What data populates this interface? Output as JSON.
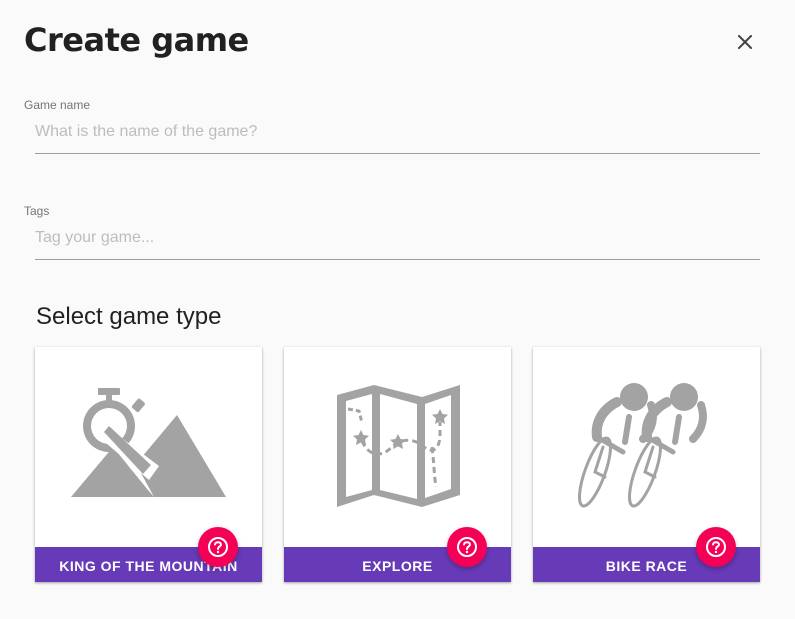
{
  "dialog": {
    "title": "Create game",
    "close_icon": "close-icon"
  },
  "fields": {
    "game_name": {
      "label": "Game name",
      "value": "",
      "placeholder": "What is the name of the game?"
    },
    "tags": {
      "label": "Tags",
      "value": "",
      "placeholder": "Tag your game..."
    }
  },
  "game_types": {
    "heading": "Select game type",
    "items": [
      {
        "label": "KING OF THE MOUNTAIN",
        "icon": "stopwatch-mountain-icon",
        "help_icon": "help-circle-icon"
      },
      {
        "label": "EXPLORE",
        "icon": "treasure-map-icon",
        "help_icon": "help-circle-icon"
      },
      {
        "label": "BIKE RACE",
        "icon": "cyclists-icon",
        "help_icon": "help-circle-icon"
      }
    ]
  },
  "colors": {
    "accent_purple": "#673ab7",
    "help_pink": "#f50057",
    "icon_gray": "#a3a3a3"
  }
}
